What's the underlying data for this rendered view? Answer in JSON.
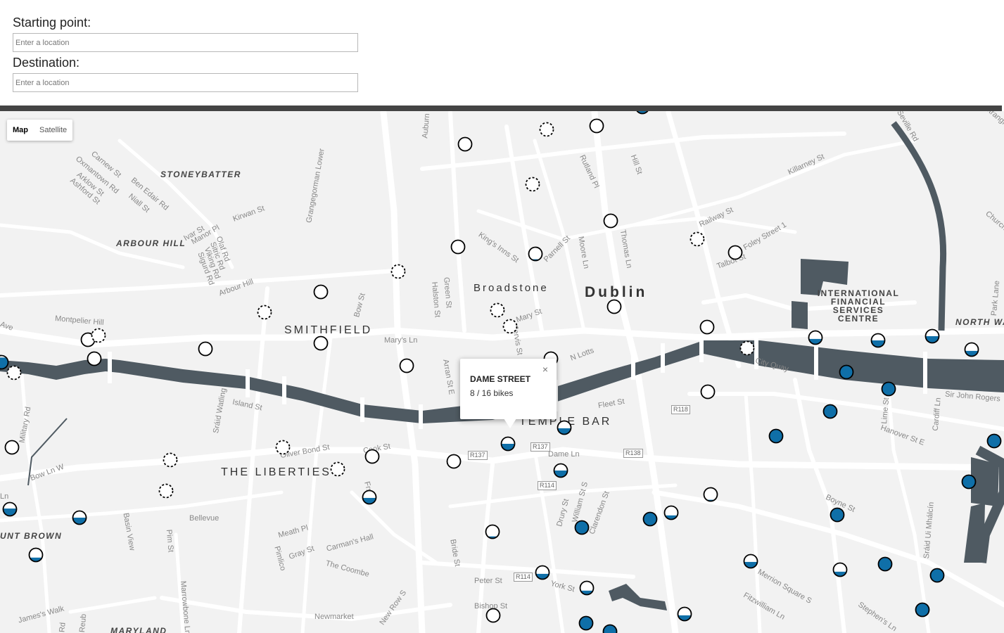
{
  "form": {
    "start_label": "Starting point:",
    "start_placeholder": "Enter a location",
    "dest_label": "Destination:",
    "dest_placeholder": "Enter a location"
  },
  "map": {
    "type_control": {
      "map": "Map",
      "satellite": "Satellite",
      "selected": "Map"
    },
    "popup": {
      "title": "DAME STREET",
      "bikes": "8 / 16 bikes",
      "close": "×"
    },
    "area_labels": [
      "STONEYBATTER",
      "ARBOUR HILL",
      "SMITHFIELD",
      "THE LIBERTIES",
      "TEMPLE BAR",
      "UNT BROWN",
      "MARYLAND",
      "NORTH WA"
    ],
    "city_label": "Dublin",
    "district_label": "Broadstone",
    "ifsc_label": "INTERNATIONAL FINANCIAL SERVICES CENTRE",
    "street_labels": [
      "Kirwan St",
      "Grangegorman Lower",
      "Rutland Pl",
      "Hill St",
      "Killarney St",
      "Railway St",
      "Foley Street 1",
      "Talbot St",
      "King's Inns St",
      "Parnell St",
      "Moore Ln",
      "Thomas Ln",
      "Mary St",
      "Mary's Ln",
      "Green St",
      "Halston St",
      "N Lotts",
      "Arbour Hill",
      "Montpelier Hill",
      "Bow St",
      "Island St",
      "Oliver Bond St",
      "Cook St",
      "Fleet St",
      "City Quay",
      "Sir John Rogers",
      "Hanover St E",
      "Lime St",
      "Cardiff Ln",
      "Dame Ln",
      "Drury St",
      "William St S",
      "Clarendon St",
      "Boyne St",
      "Merrion Square S",
      "Fitzwilliam Ln",
      "Stephen's Ln",
      "York St",
      "Peter St",
      "Bishop St",
      "Bride St",
      "Carman's Hall",
      "The Coombe",
      "Gray St",
      "Meath Pl",
      "Pimlico",
      "Bellevue",
      "Basin View",
      "Pim St",
      "Marrowbone Ln",
      "New Row S",
      "Newmarket",
      "James's Walk",
      "Bow Ln W",
      "Military Rd",
      "Arran St E",
      "Jervis St",
      "Auburn",
      "Sráid Watling",
      "Sráid Ui Mhálcín",
      "Park Lane",
      "Church",
      "Carnew St",
      "Oxmantown Rd",
      "Arklow St",
      "Ashford St",
      "Ben Edair Rd",
      "Niall St",
      "Ivar St",
      "Manor Pl",
      "Olaf Rd",
      "Sitric Rd",
      "Viking Rd",
      "Sigurd Rd",
      "Strangford",
      "Seville Rd",
      "Ave",
      "Ln",
      "Reub",
      "Rd",
      "Frs St"
    ],
    "route_badges": [
      "R118",
      "R137",
      "R137",
      "R138",
      "R114",
      "R114"
    ],
    "colors": {
      "river": "#4f5a62",
      "marker_fill": "#0f6fa8",
      "marker_stroke": "#000000",
      "land": "#f2f2f2",
      "road": "#ffffff"
    },
    "stations": [
      {
        "level": 0.0,
        "empty": false
      },
      {
        "level": 0.0,
        "empty": true
      },
      {
        "level": 0.0,
        "empty": false
      },
      {
        "level": 0.0,
        "empty": true
      },
      {
        "level": 0.0,
        "empty": false
      },
      {
        "level": 0.0,
        "empty": false
      },
      {
        "level": 0.1,
        "empty": false
      },
      {
        "level": 0.0,
        "empty": true
      },
      {
        "level": 0.0,
        "empty": false
      },
      {
        "level": 0.0,
        "empty": true
      },
      {
        "level": 0.0,
        "empty": false
      },
      {
        "level": 0.0,
        "empty": false
      },
      {
        "level": 0.0,
        "empty": true
      },
      {
        "level": 0.0,
        "empty": true
      },
      {
        "level": 0.0,
        "empty": false
      },
      {
        "level": 0.0,
        "empty": true
      },
      {
        "level": 0.0,
        "empty": false
      },
      {
        "level": 0.0,
        "empty": false
      },
      {
        "level": 0.0,
        "empty": true
      },
      {
        "level": 0.0,
        "empty": false
      },
      {
        "level": 0.0,
        "empty": true
      },
      {
        "level": 0.0,
        "empty": false
      },
      {
        "level": 0.0,
        "empty": false
      },
      {
        "level": 0.0,
        "empty": true
      },
      {
        "level": 0.0,
        "empty": false
      },
      {
        "level": 0.0,
        "empty": true
      },
      {
        "level": 0.0,
        "empty": true
      },
      {
        "level": 0.0,
        "empty": false
      },
      {
        "level": 0.0,
        "empty": true
      },
      {
        "level": 0.0,
        "empty": true
      },
      {
        "level": 0.0,
        "empty": false
      },
      {
        "level": 0.0,
        "empty": false
      },
      {
        "level": 0.1,
        "empty": false
      },
      {
        "level": 0.5,
        "empty": false
      },
      {
        "level": 0.45,
        "empty": false
      },
      {
        "level": 0.5,
        "empty": false
      },
      {
        "level": 0.15,
        "empty": false
      },
      {
        "level": 0.4,
        "empty": false
      },
      {
        "level": 0.3,
        "empty": false
      },
      {
        "level": 0.4,
        "empty": false
      },
      {
        "level": 0.5,
        "empty": false
      },
      {
        "level": 0.5,
        "empty": false
      },
      {
        "level": 0.4,
        "empty": false
      },
      {
        "level": 0.45,
        "empty": false
      },
      {
        "level": 0.35,
        "empty": false
      },
      {
        "level": 0.4,
        "empty": false
      },
      {
        "level": 0.3,
        "empty": false
      },
      {
        "level": 0.0,
        "empty": false
      },
      {
        "level": 0.1,
        "empty": false
      },
      {
        "level": 0.5,
        "empty": false
      },
      {
        "level": 0.55,
        "empty": false
      },
      {
        "level": 0.3,
        "empty": false
      },
      {
        "level": 0.45,
        "empty": false
      },
      {
        "level": 0.4,
        "empty": false
      },
      {
        "level": 0.85,
        "empty": false
      },
      {
        "level": 1.0,
        "empty": false
      },
      {
        "level": 1.0,
        "empty": false
      },
      {
        "level": 1.0,
        "empty": false
      },
      {
        "level": 1.0,
        "empty": false
      },
      {
        "level": 1.0,
        "empty": false
      },
      {
        "level": 1.0,
        "empty": false
      },
      {
        "level": 1.0,
        "empty": false
      },
      {
        "level": 1.0,
        "empty": false
      },
      {
        "level": 1.0,
        "empty": false
      },
      {
        "level": 1.0,
        "empty": false
      },
      {
        "level": 1.0,
        "empty": false
      },
      {
        "level": 1.0,
        "empty": false
      },
      {
        "level": 1.0,
        "empty": false
      },
      {
        "level": 1.0,
        "empty": false
      },
      {
        "level": 1.0,
        "empty": false
      }
    ]
  }
}
